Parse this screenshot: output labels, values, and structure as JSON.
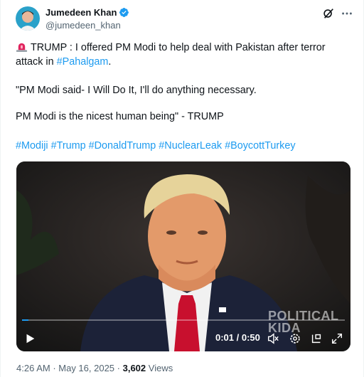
{
  "author": {
    "display_name": "Jumedeen Khan",
    "handle": "@jumedeen_khan",
    "verified": true
  },
  "tweet": {
    "line1_text": "TRUMP : I offered PM Modi to help deal with Pakistan after terror attack in ",
    "line1_hashtag": "#Pahalgam",
    "line1_end": ".",
    "quote1": "\"PM Modi said- I Will Do It, I'll do anything necessary.",
    "quote2": "PM Modi is the nicest human being\" - TRUMP",
    "hashtags": [
      "#Modiji",
      "#Trump",
      "#DonaldTrump",
      "#NuclearLeak",
      "#BoycottTurkey"
    ]
  },
  "video": {
    "current_time": "0:01",
    "separator": " / ",
    "duration": "0:50",
    "progress": 0.02,
    "watermark_line1": "POLITICAL",
    "watermark_line2": "KIDA"
  },
  "meta": {
    "time": "4:26 AM",
    "dot": " · ",
    "date": "May 16, 2025",
    "dot2": " · ",
    "views_count": "3,602",
    "views_label": " Views"
  },
  "colors": {
    "link": "#1d9bf0",
    "text": "#0f1419",
    "secondary": "#536471",
    "verified": "#1d9bf0"
  },
  "icons": [
    "siren-icon",
    "verified-badge-icon",
    "grok-icon",
    "more-icon",
    "play-icon",
    "volume-icon",
    "settings-icon",
    "popout-icon",
    "fullscreen-icon"
  ]
}
